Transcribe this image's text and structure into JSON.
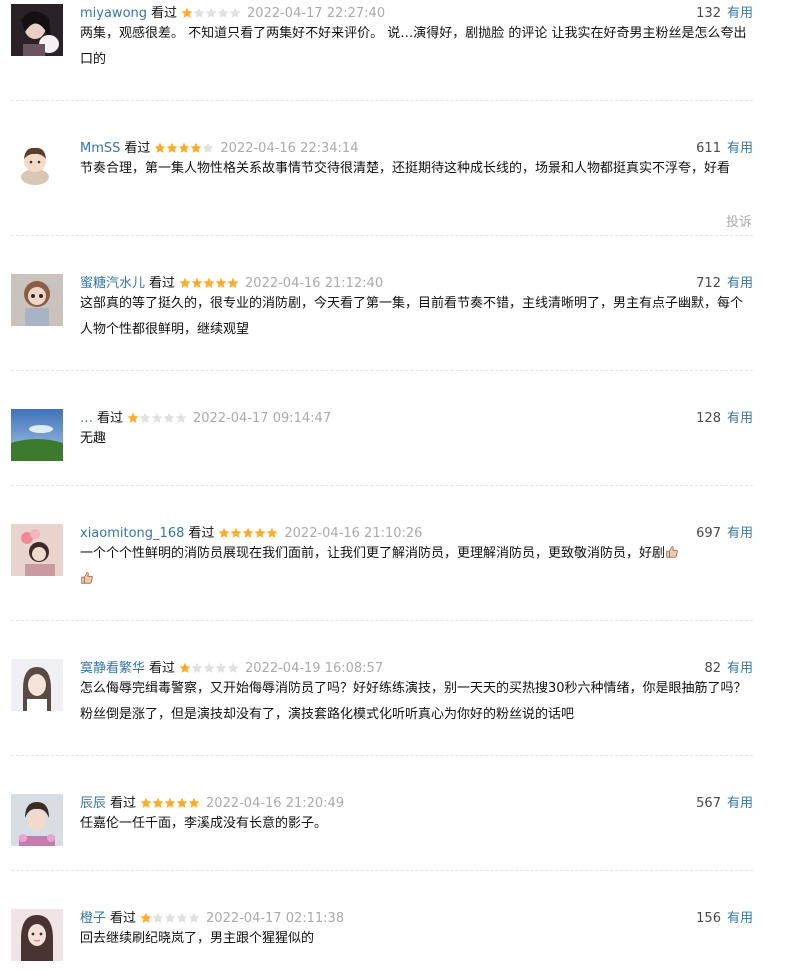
{
  "comments": [
    {
      "username": "miyawong",
      "watched": "看过",
      "rating": 1,
      "time": "2022-04-17 22:27:40",
      "votes": "132",
      "vote_label": "有用",
      "content": "两集，观感很差。 不知道只看了两集好不好来评价。 说…演得好，剧抛脸 的评论 让我实在好奇男主粉丝是怎么夸出口的"
    },
    {
      "username": "MmSS",
      "watched": "看过",
      "rating": 4,
      "time": "2022-04-16 22:34:14",
      "votes": "611",
      "vote_label": "有用",
      "content": "节奏合理，第一集人物性格关系故事情节交待很清楚，还挺期待这种成长线的，场景和人物都挺真实不浮夸，好看",
      "report_label": "投诉"
    },
    {
      "username": "蜜糖汽水儿",
      "watched": "看过",
      "rating": 5,
      "time": "2022-04-16 21:12:40",
      "votes": "712",
      "vote_label": "有用",
      "content": "这部真的等了挺久的，很专业的消防剧，今天看了第一集，目前看节奏不错，主线清晰明了，男主有点子幽默，每个人物个性都很鲜明，继续观望"
    },
    {
      "username": "…",
      "watched": "看过",
      "rating": 1,
      "time": "2022-04-17 09:14:47",
      "votes": "128",
      "vote_label": "有用",
      "content": "无趣"
    },
    {
      "username": "xiaomitong_168",
      "watched": "看过",
      "rating": 5,
      "time": "2022-04-16 21:10:26",
      "votes": "697",
      "vote_label": "有用",
      "content": "一个个个性鲜明的消防员展现在我们面前，让我们更了解消防员，更理解消防员，更致敬消防员，好剧"
    },
    {
      "username": "寞静看繁华",
      "watched": "看过",
      "rating": 1,
      "time": "2022-04-19 16:08:57",
      "votes": "82",
      "vote_label": "有用",
      "content": "怎么侮辱完缉毒警察，又开始侮辱消防员了吗？好好练练演技，别一天天的买热搜30秒六种情绪，你是眼抽筋了吗？粉丝倒是涨了，但是演技却没有了，演技套路化模式化听听真心为你好的粉丝说的话吧"
    },
    {
      "username": "辰辰",
      "watched": "看过",
      "rating": 5,
      "time": "2022-04-16 21:20:49",
      "votes": "567",
      "vote_label": "有用",
      "content": "任嘉伦一任千面，李溪成没有长意的影子。"
    },
    {
      "username": "橙子",
      "watched": "看过",
      "rating": 1,
      "time": "2022-04-17 02:11:38",
      "votes": "156",
      "vote_label": "有用",
      "content": "回去继续刷纪晓岚了，男主跟个猩猩似的"
    }
  ],
  "colors": {
    "link": "#3377aa",
    "star_filled": "#ffac2d",
    "star_empty": "#e1e1e1",
    "time": "#aaaaaa",
    "divider": "#e5e5e5"
  },
  "icons": {
    "thumb": "thumbs-up-emoji-icon"
  }
}
